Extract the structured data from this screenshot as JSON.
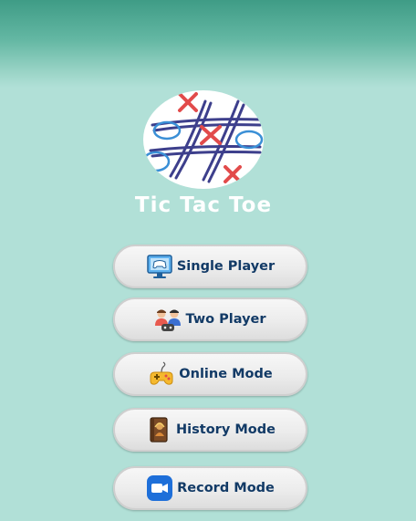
{
  "app": {
    "title": "Tic Tac Toe"
  },
  "menu": [
    {
      "id": "single-player",
      "label": "Single Player",
      "icon": "monitor-gamepad-icon"
    },
    {
      "id": "two-player",
      "label": "Two Player",
      "icon": "two-players-icon"
    },
    {
      "id": "online-mode",
      "label": "Online Mode",
      "icon": "gamepad-icon"
    },
    {
      "id": "history-mode",
      "label": "History Mode",
      "icon": "history-book-icon"
    },
    {
      "id": "record-mode",
      "label": "Record Mode",
      "icon": "video-camera-icon"
    }
  ],
  "colors": {
    "background": "#b1e0d7",
    "header": "#3f9c86",
    "button_text": "#123a66",
    "title_text": "#ffffff",
    "x_mark": "#e24b4b",
    "o_mark": "#3a8fd6",
    "grid_line": "#3d3f8c"
  }
}
